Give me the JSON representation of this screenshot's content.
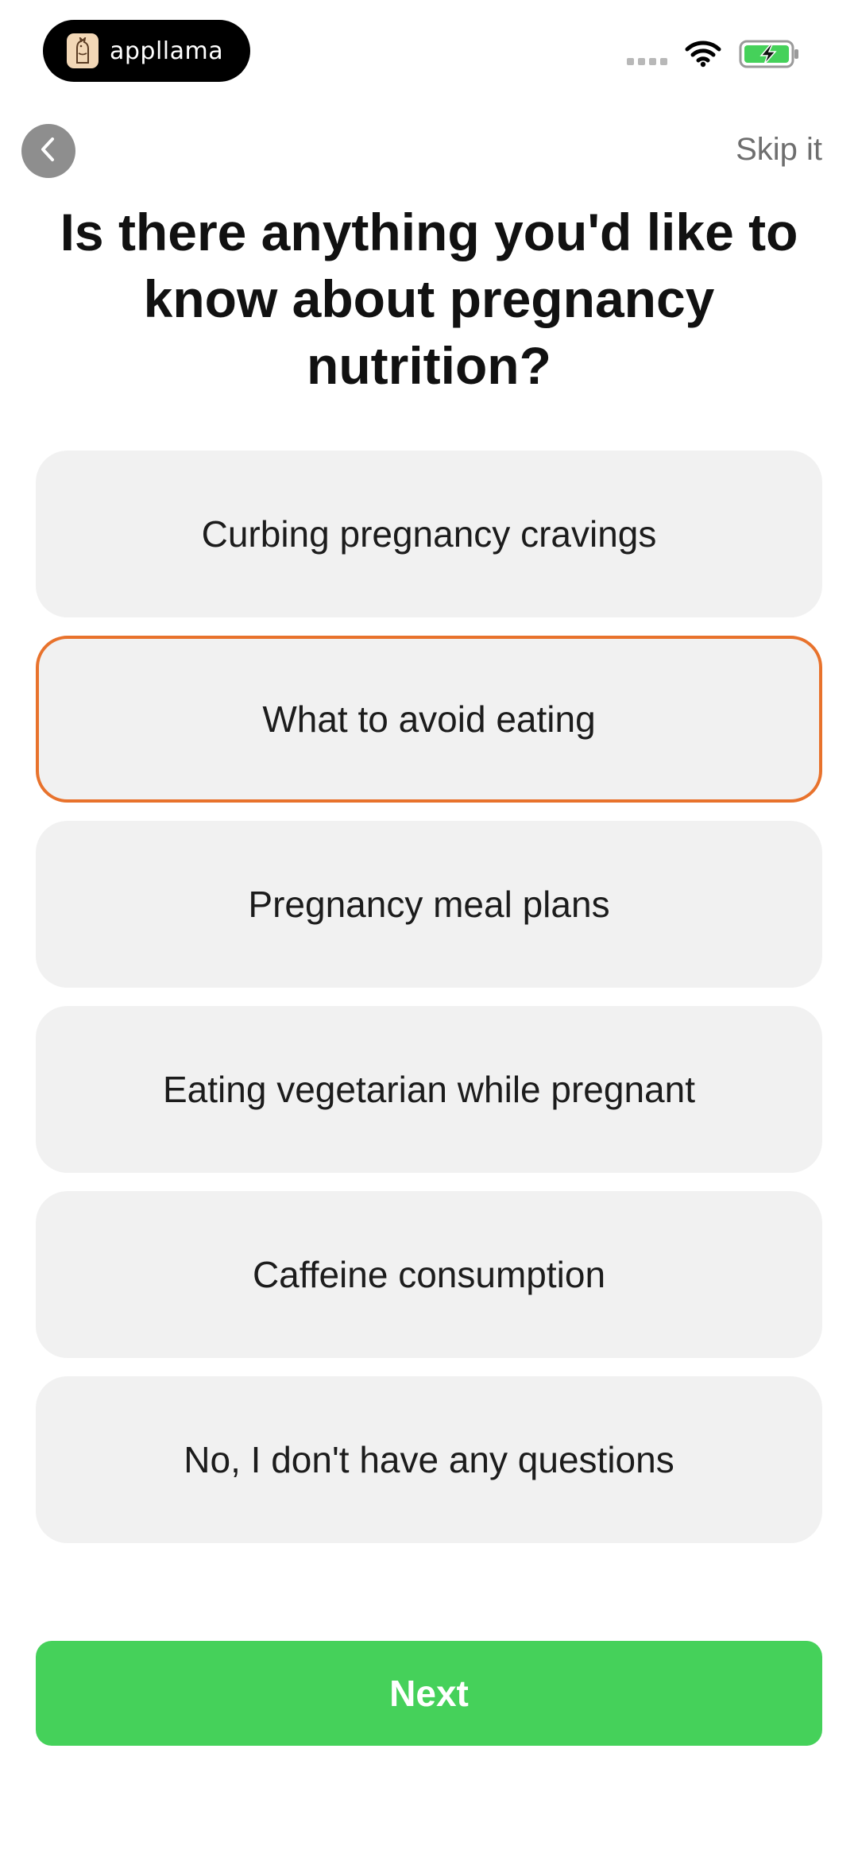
{
  "status_bar": {
    "brand_name": "appllama",
    "icons": [
      "signal-icon",
      "wifi-icon",
      "battery-charging-icon"
    ]
  },
  "nav": {
    "back_icon": "chevron-left-icon",
    "skip_label": "Skip it"
  },
  "question": {
    "title": "Is there anything you'd like to know about pregnancy nutrition?"
  },
  "options": [
    {
      "label": "Curbing pregnancy cravings",
      "selected": false
    },
    {
      "label": "What to avoid eating",
      "selected": true
    },
    {
      "label": "Pregnancy meal plans",
      "selected": false
    },
    {
      "label": "Eating vegetarian while pregnant",
      "selected": false
    },
    {
      "label": "Caffeine consumption",
      "selected": false
    },
    {
      "label": "No, I don't have any questions",
      "selected": false
    }
  ],
  "footer": {
    "next_label": "Next"
  },
  "colors": {
    "accent_selected": "#e8722c",
    "primary_button": "#45d15a",
    "option_background": "#f1f1f1"
  }
}
